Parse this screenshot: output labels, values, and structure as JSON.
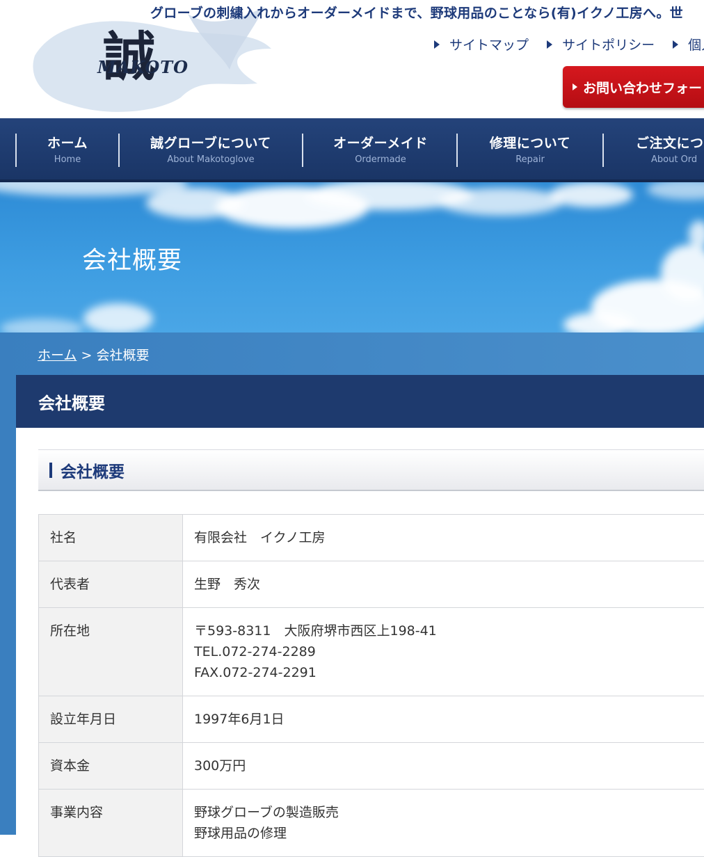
{
  "header": {
    "tagline": "グローブの刺繍入れからオーダーメイドまで、野球用品のことなら(有)イクノ工房へ。世",
    "logo_kanji": "誠",
    "logo_text": "MAKOTO",
    "sublinks": [
      "サイトマップ",
      "サイトポリシー",
      "個人"
    ],
    "contact_button": "お問い合わせフォー"
  },
  "nav": [
    {
      "jp": "ホーム",
      "en": "Home"
    },
    {
      "jp": "誠グローブについて",
      "en": "About Makotoglove"
    },
    {
      "jp": "オーダーメイド",
      "en": "Ordermade"
    },
    {
      "jp": "修理について",
      "en": "Repair"
    },
    {
      "jp": "ご注文につ",
      "en": "About Ord"
    }
  ],
  "hero": {
    "title": "会社概要"
  },
  "breadcrumb": {
    "home": "ホーム",
    "sep": " > ",
    "current": "会社概要"
  },
  "page": {
    "title": "会社概要",
    "section_title": "会社概要"
  },
  "table": [
    {
      "label": "社名",
      "lines": [
        "有限会社　イクノ工房"
      ]
    },
    {
      "label": "代表者",
      "lines": [
        "生野　秀次"
      ]
    },
    {
      "label": "所在地",
      "lines": [
        "〒593-8311　大阪府堺市西区上198-41",
        "TEL.072-274-2289",
        "FAX.072-274-2291"
      ]
    },
    {
      "label": "設立年月日",
      "lines": [
        "1997年6月1日"
      ]
    },
    {
      "label": "資本金",
      "lines": [
        "300万円"
      ]
    },
    {
      "label": "事業内容",
      "lines": [
        "野球グローブの製造販売",
        "野球用品の修理"
      ]
    }
  ],
  "colors": {
    "navy": "#1e3a6e",
    "accent_red": "#c8121a",
    "link_blue": "#1d3a7a",
    "sky_blue": "#3f9ee2"
  }
}
